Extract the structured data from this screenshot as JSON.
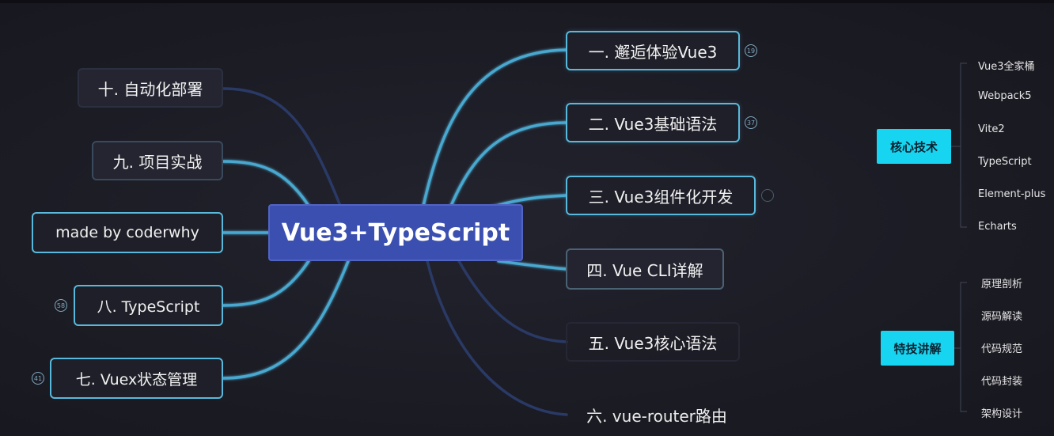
{
  "center": {
    "label": "Vue3+TypeScript"
  },
  "right_nodes": [
    {
      "label": "一. 邂逅体验Vue3",
      "badge": "19"
    },
    {
      "label": "二. Vue3基础语法",
      "badge": "37"
    },
    {
      "label": "三. Vue3组件化开发",
      "badge": ""
    },
    {
      "label": "四. Vue CLI详解",
      "badge": ""
    },
    {
      "label": "五. Vue3核心语法",
      "badge": ""
    },
    {
      "label": "六. vue-router路由",
      "badge": ""
    }
  ],
  "left_nodes": [
    {
      "label": "十. 自动化部署",
      "badge": ""
    },
    {
      "label": "九. 项目实战",
      "badge": ""
    },
    {
      "label": "made by coderwhy",
      "badge": ""
    },
    {
      "label": "八. TypeScript",
      "badge": "58"
    },
    {
      "label": "七. Vuex状态管理",
      "badge": "41"
    }
  ],
  "core_tech": {
    "label": "核心技术",
    "items": [
      "Vue3全家桶",
      "Webpack5",
      "Vite2",
      "TypeScript",
      "Element-plus",
      "Echarts"
    ]
  },
  "special_tech": {
    "label": "特技讲解",
    "items": [
      "原理剖析",
      "源码解读",
      "代码规范",
      "代码封装",
      "架构设计"
    ]
  },
  "colors": {
    "accent": "#58b9dc",
    "center_fill": "#3a4fb0",
    "category_fill": "#17d4f0",
    "background": "#1c1c25"
  }
}
